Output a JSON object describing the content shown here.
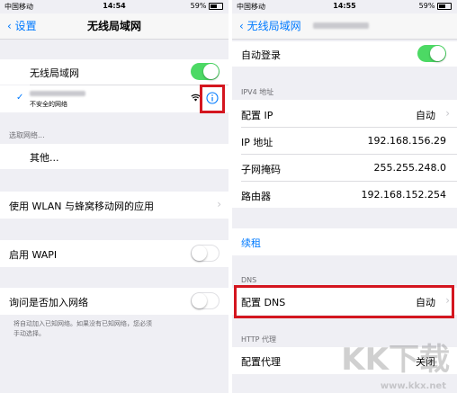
{
  "left": {
    "status": {
      "carrier": "中国移动",
      "time": "14:54",
      "battery": "59%"
    },
    "nav": {
      "back_label": "设置",
      "title": "无线局域网"
    },
    "wifi_toggle": {
      "label": "无线局域网",
      "on": true
    },
    "connected_network": {
      "subtitle": "不安全的网络",
      "info_icon": "info-icon"
    },
    "choose_header": "选取网络...",
    "other_label": "其他...",
    "apps_label": "使用 WLAN 与蜂窝移动网的应用",
    "wapi": {
      "label": "启用 WAPI",
      "on": false
    },
    "ask_join": {
      "label": "询问是否加入网络",
      "on": false
    },
    "footnote_line1": "将自动加入已知网络。如果没有已知网络，您必须",
    "footnote_line2": "手动选择。"
  },
  "right": {
    "status": {
      "carrier": "中国移动",
      "time": "14:55",
      "battery": "59%"
    },
    "nav": {
      "back_label": "无线局域网"
    },
    "auto_login": {
      "label": "自动登录",
      "on": true
    },
    "ipv4_header": "IPV4 地址",
    "configure_ip": {
      "label": "配置 IP",
      "value": "自动"
    },
    "ip_address": {
      "label": "IP 地址",
      "value": "192.168.156.29"
    },
    "subnet_mask": {
      "label": "子网掩码",
      "value": "255.255.248.0"
    },
    "router": {
      "label": "路由器",
      "value": "192.168.152.254"
    },
    "renew_lease": "续租",
    "dns_header": "DNS",
    "configure_dns": {
      "label": "配置 DNS",
      "value": "自动"
    },
    "http_proxy_header": "HTTP 代理",
    "configure_proxy": {
      "label": "配置代理",
      "value": "关闭"
    }
  },
  "watermark": {
    "logo": "KK下载",
    "url": "www.kkx.net"
  },
  "colors": {
    "accent": "#007aff",
    "toggle_on": "#4cd964",
    "highlight": "#d4161f",
    "background": "#efeff4"
  }
}
